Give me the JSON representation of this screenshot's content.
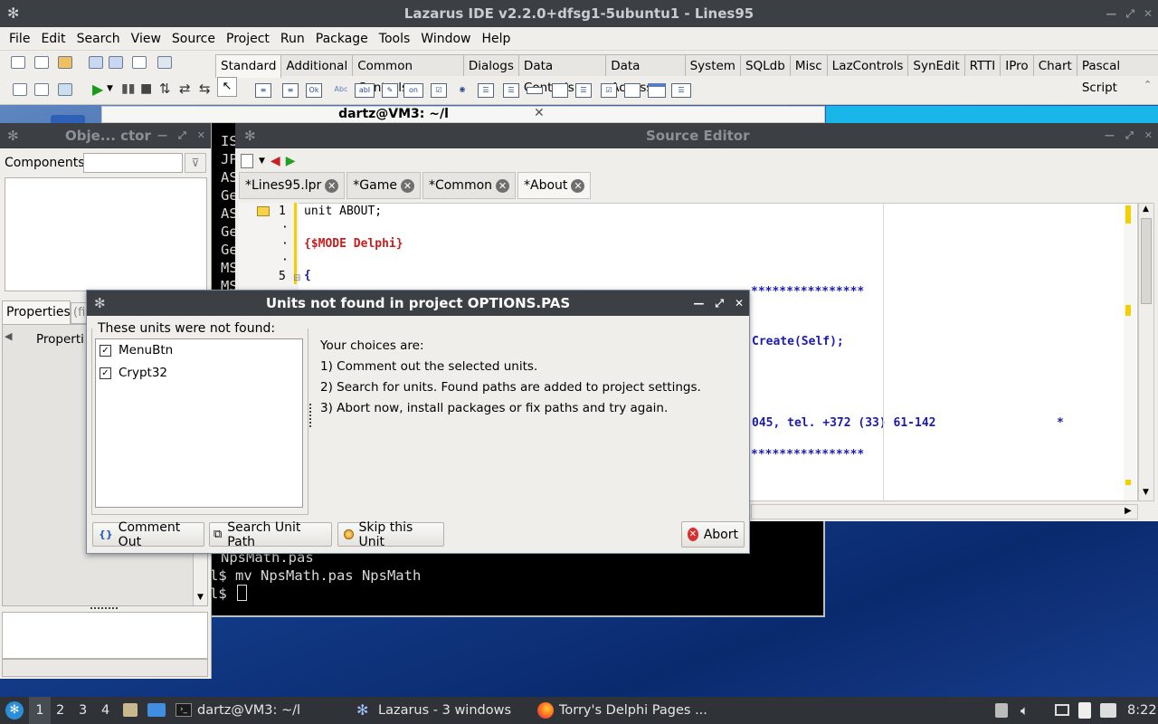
{
  "app": {
    "title": "Lazarus IDE v2.2.0+dfsg1-5ubuntu1 - Lines95"
  },
  "menu": [
    "File",
    "Edit",
    "Search",
    "View",
    "Source",
    "Project",
    "Run",
    "Package",
    "Tools",
    "Window",
    "Help"
  ],
  "palette_tabs": [
    "Standard",
    "Additional",
    "Common Controls",
    "Dialogs",
    "Data Controls",
    "Data Access",
    "System",
    "SQLdb",
    "Misc",
    "LazControls",
    "SynEdit",
    "RTTI",
    "IPro",
    "Chart",
    "Pascal Script"
  ],
  "palette_icons": [
    "Ok",
    "Abc",
    "abI",
    "on"
  ],
  "terminal": {
    "title": "dartz@VM3: ~/l",
    "lines_left": [
      "IS",
      "JP",
      "AS",
      "Ge",
      "AS",
      "Ge",
      "Ge",
      "MS",
      "MS"
    ],
    "bottom_lines": [
      "NpsMath.pas",
      "l$ mv NpsMath.pas NpsMath",
      "l$ "
    ]
  },
  "object_inspector": {
    "title": "Obje... ctor",
    "components_label": "Components",
    "properties_tab": "Properties",
    "properties_tab2": "(fi",
    "properties_header": "Properti"
  },
  "source_editor": {
    "title": "Source Editor",
    "tabs": [
      "*Lines95.lpr",
      "*Game",
      "*Common",
      "*About"
    ],
    "gutter": [
      "1",
      "·",
      "·",
      "·",
      "5"
    ],
    "code": [
      "unit ABOUT;",
      "",
      "{$MODE Delphi}",
      "",
      "{"
    ],
    "right_fragments": [
      "****************",
      "Create(Self);",
      "045, tel. +372 (33) 61-142",
      "*",
      "****************"
    ]
  },
  "dialog": {
    "title": "Units not found in project OPTIONS.PAS",
    "group_label": "These units were not found:",
    "units": [
      "MenuBtn",
      "Crypt32"
    ],
    "choices_title": "Your choices are:",
    "choices": [
      "1) Comment out the selected units.",
      "2) Search for units. Found paths are added to project settings.",
      "3) Abort now, install packages or fix paths and try again."
    ],
    "buttons": {
      "comment_out": "Comment Out",
      "search_path": "Search Unit Path",
      "skip": "Skip this Unit",
      "abort": "Abort"
    },
    "comment_icon": "{}"
  },
  "taskbar": {
    "workspaces": [
      "1",
      "2",
      "3",
      "4"
    ],
    "tasks": [
      "dartz@VM3: ~/l",
      "Lazarus - 3 windows",
      "Torry's Delphi Pages ..."
    ],
    "clock": "8:22"
  },
  "colors": {
    "titlebar": "#3c3f44",
    "terminal_bg": "#000000",
    "accent_cyan": "#19b6ea",
    "directive_red": "#c81e1e",
    "code_blue": "#1b1bb0"
  }
}
